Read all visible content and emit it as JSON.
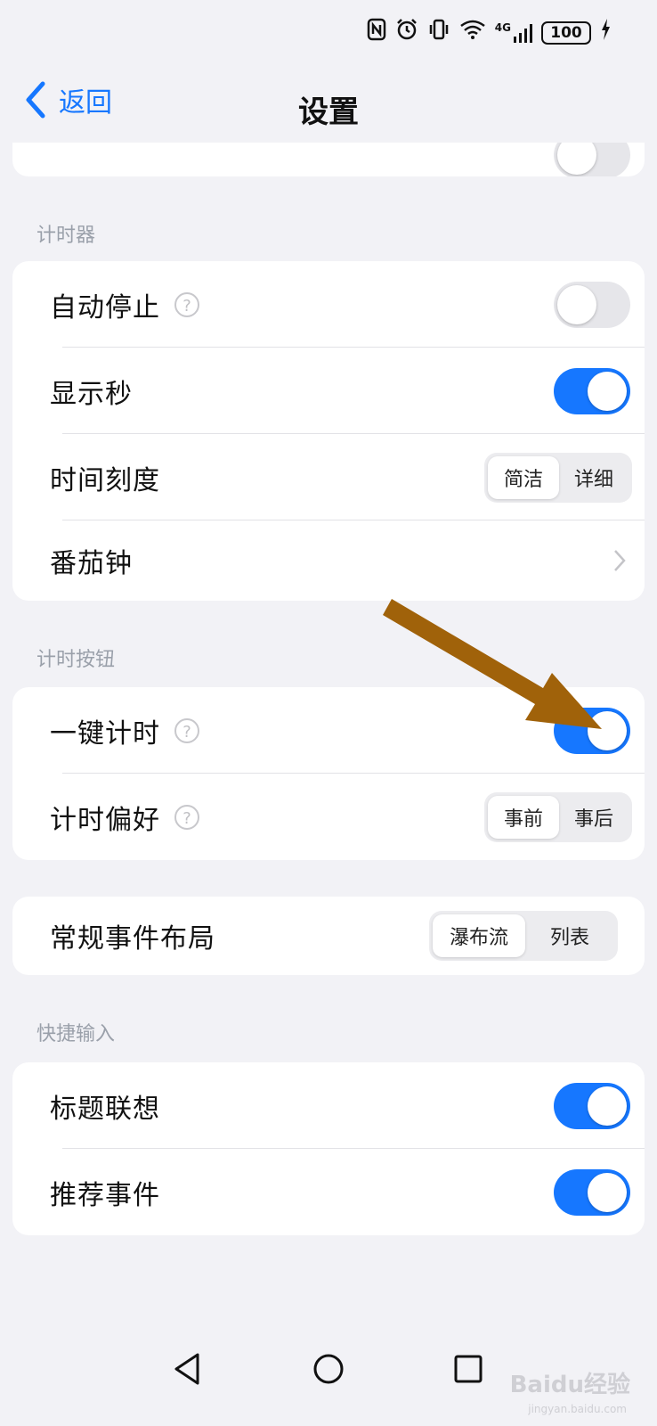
{
  "status_bar": {
    "icons": [
      "nfc-icon",
      "alarm-icon",
      "vibrate-icon",
      "wifi-icon",
      "4g-signal-icon",
      "battery-icon",
      "charging-icon"
    ],
    "signal_label": "4G",
    "battery": "100"
  },
  "header": {
    "back_label": "返回",
    "title": "设置"
  },
  "sections": {
    "timer": {
      "header": "计时器",
      "auto_stop": {
        "label": "自动停止",
        "on": false
      },
      "show_seconds": {
        "label": "显示秒",
        "on": true
      },
      "time_scale": {
        "label": "时间刻度",
        "options": [
          "简洁",
          "详细"
        ],
        "selected": "简洁"
      },
      "pomodoro": {
        "label": "番茄钟"
      }
    },
    "timer_button": {
      "header": "计时按钮",
      "one_tap": {
        "label": "一键计时",
        "on": true
      },
      "preference": {
        "label": "计时偏好",
        "options": [
          "事前",
          "事后"
        ],
        "selected": "事前"
      }
    },
    "layout": {
      "event_layout": {
        "label": "常规事件布局",
        "options": [
          "瀑布流",
          "列表"
        ],
        "selected": "瀑布流"
      }
    },
    "quick_input": {
      "header": "快捷输入",
      "title_suggest": {
        "label": "标题联想",
        "on": true
      },
      "recommend": {
        "label": "推荐事件",
        "on": true
      }
    }
  },
  "watermark": {
    "brand": "Baidu经验",
    "url": "jingyan.baidu.com"
  },
  "colors": {
    "accent": "#1677ff",
    "background": "#f2f2f6",
    "annotation_arrow": "#a0620a"
  }
}
